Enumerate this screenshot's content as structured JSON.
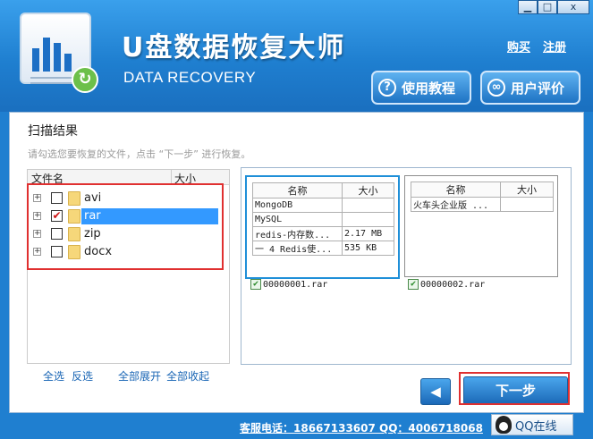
{
  "window": {
    "title": "U盘数据恢复大师",
    "subtitle": "DATA RECOVERY",
    "minimize": "▁",
    "maximize": "□",
    "close": "x"
  },
  "header": {
    "links": [
      "购买",
      "注册"
    ],
    "tutorial_button": "使用教程",
    "review_button": "用户评价"
  },
  "panel": {
    "title": "扫描结果",
    "hint": "请勾选您要恢复的文件，点击 “下一步” 进行恢复。"
  },
  "tree": {
    "columns": [
      "文件名",
      "大小"
    ],
    "items": [
      {
        "label": "avi",
        "checked": false,
        "selected": false
      },
      {
        "label": "rar",
        "checked": true,
        "selected": true
      },
      {
        "label": "zip",
        "checked": false,
        "selected": false
      },
      {
        "label": "docx",
        "checked": false,
        "selected": false
      }
    ],
    "actions": [
      "全选",
      "反选",
      "全部展开",
      "全部收起"
    ]
  },
  "files": [
    {
      "columns": [
        "名称",
        "大小"
      ],
      "rows": [
        [
          "MongoDB",
          ""
        ],
        [
          "MySQL",
          ""
        ],
        [
          "redis-内存数...",
          "2.17 MB"
        ],
        [
          "一 4 Redis使...",
          "535 KB"
        ]
      ],
      "filename": "00000001.rar",
      "checked": true,
      "active": true
    },
    {
      "columns": [
        "名称",
        "大小"
      ],
      "rows": [
        [
          "火车头企业版 ...",
          ""
        ]
      ],
      "filename": "00000002.rar",
      "checked": true,
      "active": false
    }
  ],
  "nav": {
    "back": "◀",
    "next": "下一步"
  },
  "footer": {
    "contact": "客服电话：18667133607 QQ：4006718068",
    "qq_button": "QQ在线"
  },
  "colors": {
    "brand_blue": "#1f7fd0",
    "highlight_red": "#e03030",
    "selection_blue": "#3399ff"
  }
}
